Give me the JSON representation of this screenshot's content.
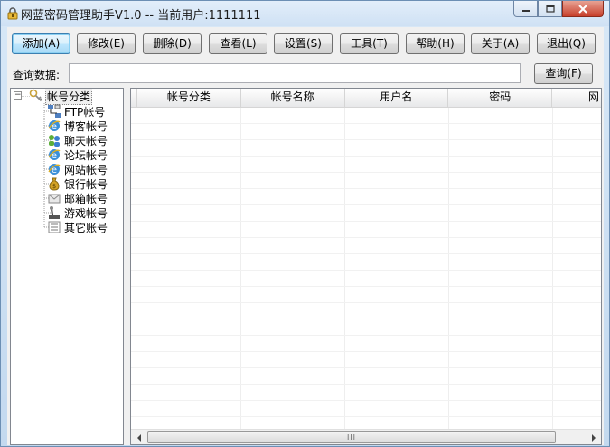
{
  "window": {
    "title": "网蓝密码管理助手V1.0 -- 当前用户:1111111",
    "controls": {
      "minimize": "minimize",
      "maximize": "maximize",
      "close": "close"
    }
  },
  "toolbar": {
    "buttons": [
      {
        "label": "添加(A)",
        "icon": "none",
        "active": true
      },
      {
        "label": "修改(E)"
      },
      {
        "label": "删除(D)"
      },
      {
        "label": "查看(L)"
      },
      {
        "label": "设置(S)"
      },
      {
        "label": "工具(T)"
      },
      {
        "label": "帮助(H)"
      },
      {
        "label": "关于(A)"
      },
      {
        "label": "退出(Q)"
      }
    ]
  },
  "search": {
    "label": "查询数据:",
    "value": "",
    "button": "查询(F)"
  },
  "tree": {
    "root": {
      "label": "帐号分类",
      "icon": "key-ring-icon",
      "expanded": true
    },
    "items": [
      {
        "label": "FTP帐号",
        "icon": "network-icon"
      },
      {
        "label": "博客帐号",
        "icon": "ie-icon"
      },
      {
        "label": "聊天帐号",
        "icon": "chat-users-icon"
      },
      {
        "label": "论坛帐号",
        "icon": "ie-icon"
      },
      {
        "label": "网站帐号",
        "icon": "ie-icon"
      },
      {
        "label": "银行帐号",
        "icon": "money-bag-icon"
      },
      {
        "label": "邮箱帐号",
        "icon": "mail-icon"
      },
      {
        "label": "游戏帐号",
        "icon": "joystick-icon"
      },
      {
        "label": "其它账号",
        "icon": "list-icon"
      }
    ]
  },
  "grid": {
    "columns": [
      "帐号分类",
      "帐号名称",
      "用户名",
      "密码",
      "网"
    ],
    "rows": [],
    "scroll_thumb": "III"
  },
  "colors": {
    "window_frame": "#c3d9ef",
    "close_button": "#c7402c",
    "accent": "#3c7fb1"
  }
}
